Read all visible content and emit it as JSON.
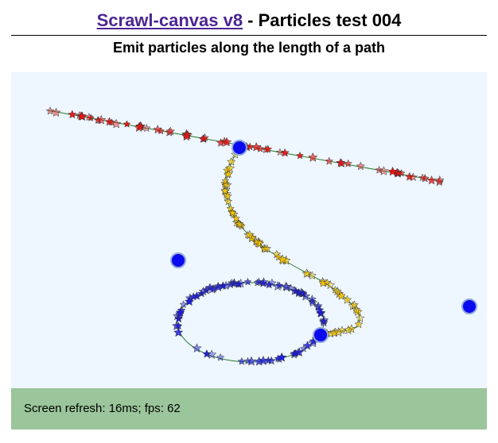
{
  "header": {
    "link_text": "Scrawl-canvas v8",
    "title_suffix": " - Particles test 004"
  },
  "subtitle": "Emit particles along the length of a path",
  "report": {
    "text": "Screen refresh: 16ms; fps: 62"
  },
  "colors": {
    "link": "#4b2593",
    "canvas_background": "#eef6ff",
    "report_background": "#9bc59b",
    "pin_fill": "#0a0af0",
    "pin_stroke": "#8fa8d8",
    "red_particles": "#ee1111",
    "yellow_particles": "#f5c400",
    "blue_particles": "#1a1adf",
    "path_stroke": "#2e7d32"
  },
  "canvas": {
    "pins": [
      {
        "name": "pin-line-end"
      },
      {
        "name": "pin-curve-control"
      },
      {
        "name": "pin-right-control"
      },
      {
        "name": "pin-ellipse-anchor"
      }
    ],
    "emitters": [
      {
        "name": "red-emitter",
        "shape": "star",
        "color": "red_particles"
      },
      {
        "name": "yellow-emitter",
        "shape": "star",
        "color": "yellow_particles"
      },
      {
        "name": "blue-emitter",
        "shape": "star",
        "color": "blue_particles"
      }
    ]
  }
}
